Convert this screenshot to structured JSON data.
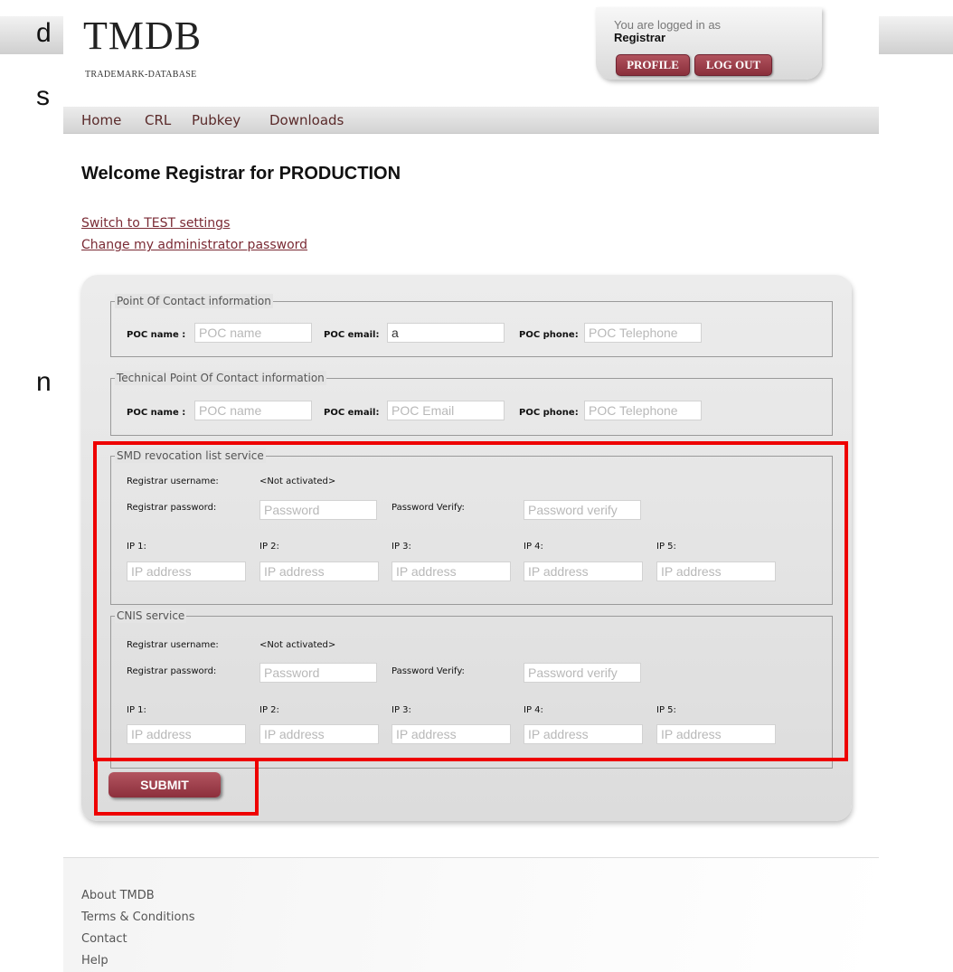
{
  "background_text": [
    "d",
    "s",
    "n"
  ],
  "header": {
    "logo": "TMDB",
    "logo_sub": "TRADEMARK-DATABASE",
    "logged_in_as": "You are logged in as",
    "user": "Registrar",
    "profile_label": "PROFILE",
    "logout_label": "LOG OUT"
  },
  "nav": [
    "Home",
    "CRL",
    "Pubkey",
    "Downloads"
  ],
  "welcome": "Welcome Registrar  for PRODUCTION",
  "links": {
    "switch": "Switch to TEST settings",
    "change_pw": "Change my administrator password"
  },
  "poc": {
    "legend": "Point Of Contact information",
    "name_label": "POC name :",
    "name_placeholder": "POC name",
    "email_label": "POC email:",
    "email_value": "a",
    "phone_label": "POC phone:",
    "phone_placeholder": "POC Telephone"
  },
  "tech_poc": {
    "legend": "Technical Point Of Contact information",
    "name_label": "POC name :",
    "name_placeholder": "POC name",
    "email_label": "POC email:",
    "email_placeholder": "POC Email",
    "phone_label": "POC phone:",
    "phone_placeholder": "POC Telephone"
  },
  "smd": {
    "legend": "SMD revocation list service",
    "username_label": "Registrar username:",
    "username_value": "<Not activated>",
    "password_label": "Registrar password:",
    "password_placeholder": "Password",
    "verify_label": "Password Verify:",
    "verify_placeholder": "Password verify",
    "ip_labels": [
      "IP 1:",
      "IP 2:",
      "IP 3:",
      "IP 4:",
      "IP 5:"
    ],
    "ip_placeholder": "IP address"
  },
  "cnis": {
    "legend": "CNIS service",
    "username_label": "Registrar username:",
    "username_value": "<Not activated>",
    "password_label": "Registrar password:",
    "password_placeholder": "Password",
    "verify_label": "Password Verify:",
    "verify_placeholder": "Password verify",
    "ip_labels": [
      "IP 1:",
      "IP 2:",
      "IP 3:",
      "IP 4:",
      "IP 5:"
    ],
    "ip_placeholder": "IP address"
  },
  "submit_label": "SUBMIT",
  "footer": [
    "About TMDB",
    "Terms & Conditions",
    "Contact",
    "Help"
  ],
  "colors": {
    "brand": "#8c2f3c",
    "highlight": "#ee0000"
  }
}
